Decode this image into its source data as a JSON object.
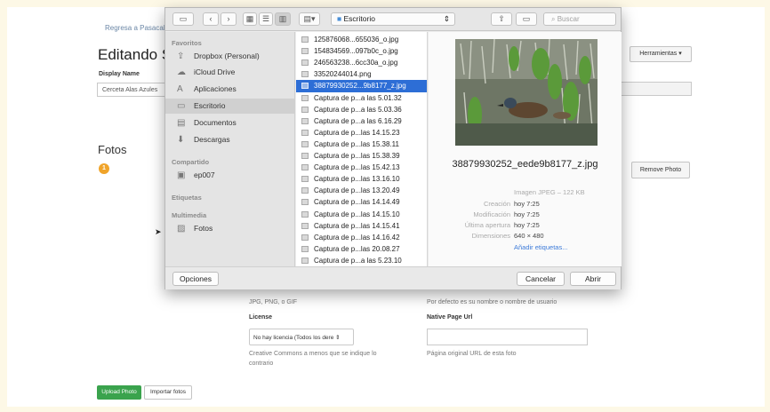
{
  "page": {
    "back_link": "Regresa a Pasacaba",
    "title": "Editando S",
    "display_name_label": "Display Name",
    "display_name_value": "Cerceta Alas Azules",
    "herramientas": "Herramientas ▾",
    "photos_heading": "Fotos",
    "photo_number": "1",
    "remove_photo": "Remove Photo",
    "formats": "JPG, PNG, o GIF",
    "default_hint": "Por defecto es su nombre o nombre de usuario",
    "license_label": "License",
    "license_value": "No hay licencia (Todos los dere ⇕",
    "license_help_1": "Creative Commons a menos que se indique lo",
    "license_help_2": "contrario",
    "native_url_label": "Native Page Url",
    "native_url_value": "",
    "native_url_help": "Página original URL de esta foto",
    "upload_button": "Upload Photo",
    "import_button": "Importar fotos"
  },
  "dialog": {
    "toolbar": {
      "location": "Escritorio",
      "search_placeholder": "Buscar",
      "sidebar_toggle_icon": "sidebar-icon",
      "back_icon": "chevron-left-icon",
      "forward_icon": "chevron-right-icon"
    },
    "sidebar": {
      "favorites_heading": "Favoritos",
      "favorites": [
        {
          "label": "Dropbox (Personal)",
          "icon": "⇪"
        },
        {
          "label": "iCloud Drive",
          "icon": "☁"
        },
        {
          "label": "Aplicaciones",
          "icon": "A"
        },
        {
          "label": "Escritorio",
          "icon": "▭"
        },
        {
          "label": "Documentos",
          "icon": "▤"
        },
        {
          "label": "Descargas",
          "icon": "⬇"
        }
      ],
      "shared_heading": "Compartido",
      "shared": [
        {
          "label": "ep007",
          "icon": "▣"
        }
      ],
      "tags_heading": "Etiquetas",
      "media_heading": "Multimedia",
      "media": [
        {
          "label": "Fotos",
          "icon": "▨"
        }
      ]
    },
    "files": [
      "125876068...655036_o.jpg",
      "154834569...097b0c_o.jpg",
      "246563238...6cc30a_o.jpg",
      "33520244014.png",
      "38879930252...9b8177_z.jpg",
      "Captura de p...a las 5.01.32",
      "Captura de p...a las 5.03.36",
      "Captura de p...a las 6.16.29",
      "Captura de p...las 14.15.23",
      "Captura de p...las 15.38.11",
      "Captura de p...las 15.38.39",
      "Captura de p...las 15.42.13",
      "Captura de p...las 13.16.10",
      "Captura de p...las 13.20.49",
      "Captura de p...las 14.14.49",
      "Captura de p...las 14.15.10",
      "Captura de p...las 14.15.41",
      "Captura de p...las 14.16.42",
      "Captura de p...las 20.08.27",
      "Captura de p...a las 5.23.10"
    ],
    "selected_file_index": 4,
    "preview": {
      "filename": "38879930252_eede9b8177_z.jpg",
      "kind": "Imagen JPEG – 122 KB",
      "rows": [
        {
          "k": "Creación",
          "v": "hoy 7:25"
        },
        {
          "k": "Modificación",
          "v": "hoy 7:25"
        },
        {
          "k": "Última apertura",
          "v": "hoy 7:25"
        },
        {
          "k": "Dimensiones",
          "v": "640 × 480"
        }
      ],
      "add_tags": "Añadir etiquetas..."
    },
    "footer": {
      "options": "Opciones",
      "cancel": "Cancelar",
      "open": "Abrir"
    }
  },
  "colors": {
    "selection": "#2d6ed6",
    "accent_green": "#3aa34d",
    "badge_orange": "#f0a42a"
  }
}
